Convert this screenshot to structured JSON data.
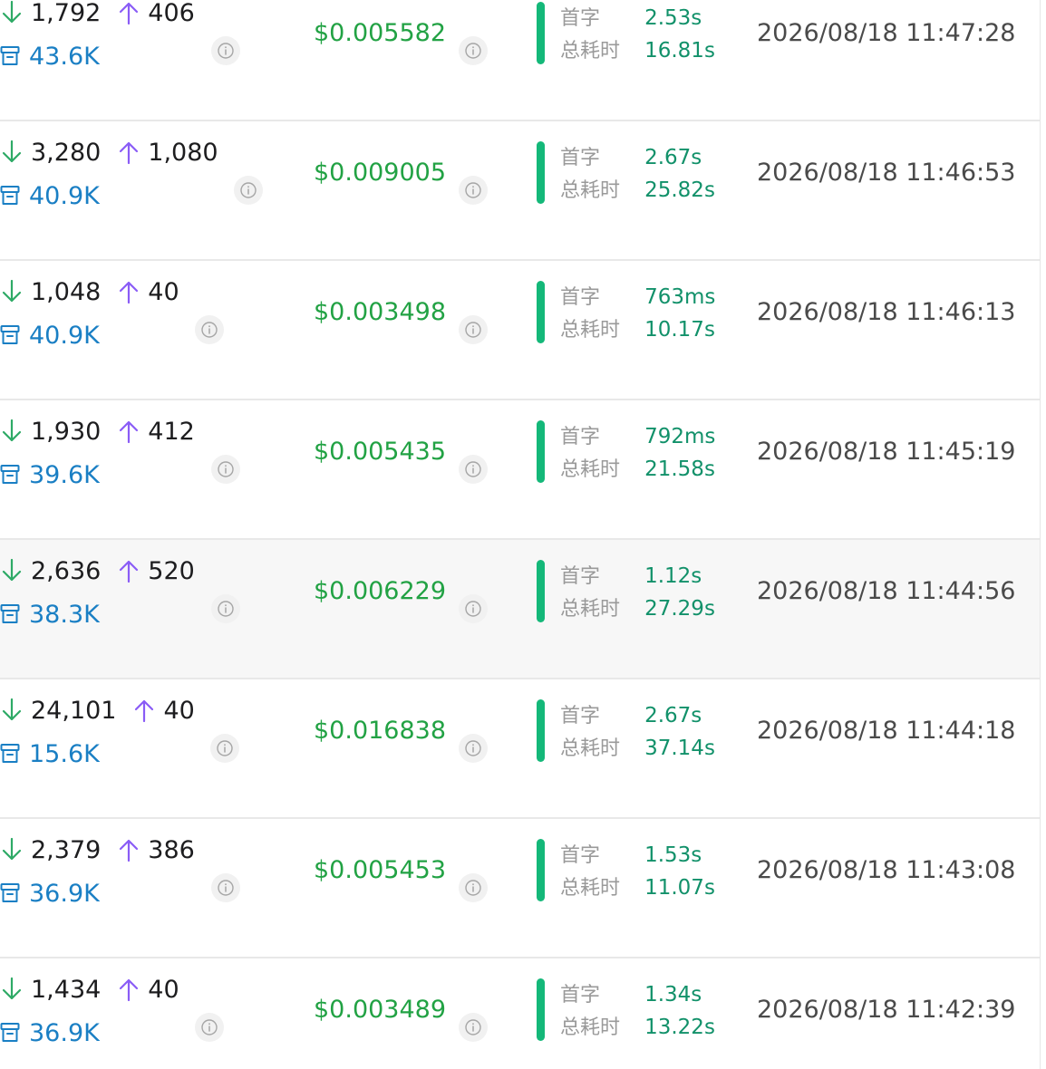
{
  "labels": {
    "first_token": "首字",
    "total_time": "总耗时"
  },
  "icons": {
    "input_tokens": "arrow-down-icon",
    "output_tokens": "arrow-up-icon",
    "cache": "archive-icon",
    "info": "info-icon"
  },
  "colors": {
    "input_arrow": "#2eaa66",
    "output_arrow": "#8a5cf6",
    "cache_text": "#1a7fc4",
    "cost": "#22a244",
    "timing_bar": "#14b879",
    "timing_value": "#12916a"
  },
  "rows": [
    {
      "input": "1,792",
      "output": "406",
      "cache": "43.6K",
      "cost": "$0.005582",
      "first_token": "2.53s",
      "total_time": "16.81s",
      "timestamp": "2026/08/18 11:47:28"
    },
    {
      "input": "3,280",
      "output": "1,080",
      "cache": "40.9K",
      "cost": "$0.009005",
      "first_token": "2.67s",
      "total_time": "25.82s",
      "timestamp": "2026/08/18 11:46:53"
    },
    {
      "input": "1,048",
      "output": "40",
      "cache": "40.9K",
      "cost": "$0.003498",
      "first_token": "763ms",
      "total_time": "10.17s",
      "timestamp": "2026/08/18 11:46:13"
    },
    {
      "input": "1,930",
      "output": "412",
      "cache": "39.6K",
      "cost": "$0.005435",
      "first_token": "792ms",
      "total_time": "21.58s",
      "timestamp": "2026/08/18 11:45:19"
    },
    {
      "input": "2,636",
      "output": "520",
      "cache": "38.3K",
      "cost": "$0.006229",
      "first_token": "1.12s",
      "total_time": "27.29s",
      "timestamp": "2026/08/18 11:44:56",
      "hovered": true
    },
    {
      "input": "24,101",
      "output": "40",
      "cache": "15.6K",
      "cost": "$0.016838",
      "first_token": "2.67s",
      "total_time": "37.14s",
      "timestamp": "2026/08/18 11:44:18"
    },
    {
      "input": "2,379",
      "output": "386",
      "cache": "36.9K",
      "cost": "$0.005453",
      "first_token": "1.53s",
      "total_time": "11.07s",
      "timestamp": "2026/08/18 11:43:08"
    },
    {
      "input": "1,434",
      "output": "40",
      "cache": "36.9K",
      "cost": "$0.003489",
      "first_token": "1.34s",
      "total_time": "13.22s",
      "timestamp": "2026/08/18 11:42:39"
    }
  ]
}
